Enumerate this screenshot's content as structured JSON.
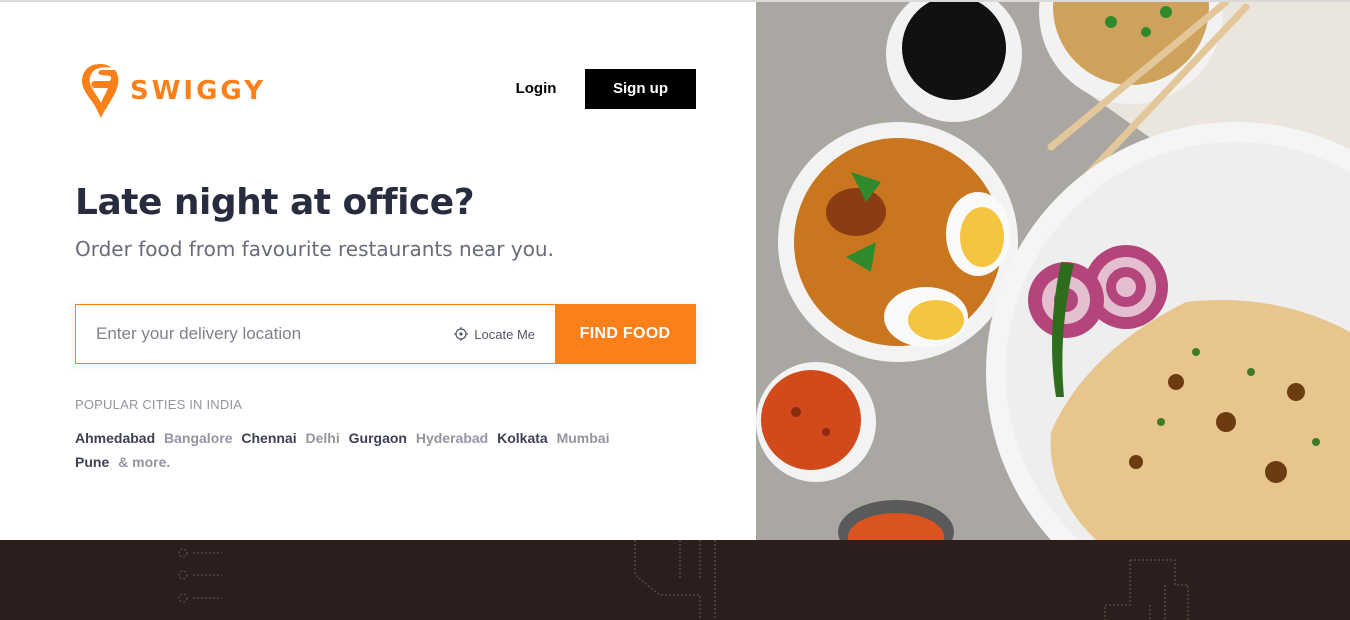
{
  "brand": {
    "name": "SWIGGY",
    "color": "#fc8019"
  },
  "header": {
    "login_label": "Login",
    "signup_label": "Sign up"
  },
  "hero": {
    "headline": "Late night at office?",
    "subheadline": "Order food from favourite restaurants near you."
  },
  "search": {
    "placeholder": "Enter your delivery location",
    "value": "",
    "locate_label": "Locate Me",
    "locate_icon": "crosshair-icon",
    "submit_label": "FIND FOOD"
  },
  "popular": {
    "label": "POPULAR CITIES IN INDIA",
    "cities": [
      {
        "name": "Ahmedabad",
        "tone": "dark"
      },
      {
        "name": "Bangalore",
        "tone": "light"
      },
      {
        "name": "Chennai",
        "tone": "dark"
      },
      {
        "name": "Delhi",
        "tone": "light"
      },
      {
        "name": "Gurgaon",
        "tone": "dark"
      },
      {
        "name": "Hyderabad",
        "tone": "light"
      },
      {
        "name": "Kolkata",
        "tone": "dark"
      },
      {
        "name": "Mumbai",
        "tone": "light"
      },
      {
        "name": "Pune",
        "tone": "dark"
      }
    ],
    "more_label": "& more."
  },
  "colors": {
    "accent": "#fc8019",
    "heading": "#282c3f",
    "footer_bg": "#2b1e1c"
  }
}
